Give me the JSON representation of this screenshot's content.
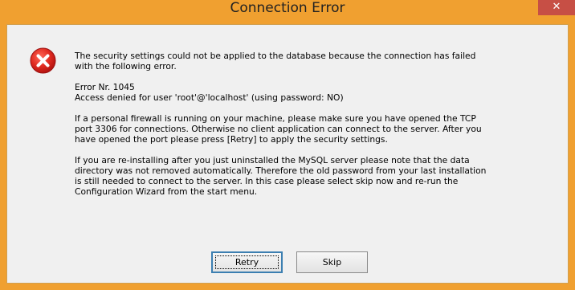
{
  "window": {
    "title": "Connection Error",
    "close_label": "✕"
  },
  "icons": {
    "error": "error-icon",
    "close": "close-icon"
  },
  "colors": {
    "titlebar": "#f0a030",
    "close_button": "#c74f45",
    "error_icon": "#d82020"
  },
  "message": {
    "intro_line1": "The security settings could not be applied to the database because the connection has failed",
    "intro_line2": "with the following error.",
    "error_number": "Error Nr. 1045",
    "error_detail": "Access denied for user 'root'@'localhost' (using password: NO)",
    "firewall_line1": "If a personal firewall is running on your machine, please make sure you have opened the TCP",
    "firewall_line2": "port 3306 for connections. Otherwise no client application can connect to the server. After you",
    "firewall_line3": "have opened the port please press [Retry] to apply the security settings.",
    "reinstall_line1": "If you are re-installing after you just uninstalled the MySQL server please note that the data",
    "reinstall_line2": "directory was not removed automatically. Therefore the old password from your last installation",
    "reinstall_line3": "is still needed to connect to the server. In this case please select skip now and re-run the",
    "reinstall_line4": "Configuration Wizard from the start menu."
  },
  "buttons": {
    "retry": "Retry",
    "skip": "Skip"
  }
}
